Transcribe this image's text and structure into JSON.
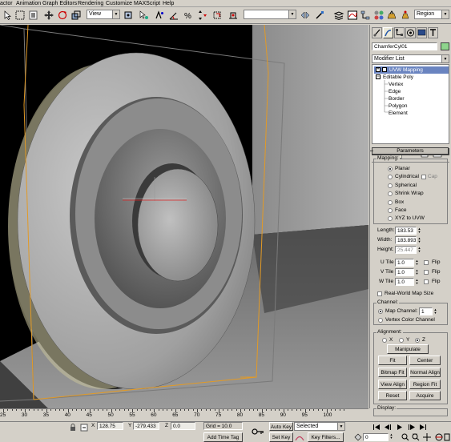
{
  "menubar": {
    "items": [
      "actor",
      "Animation",
      "Graph Editors",
      "Rendering",
      "Customize",
      "MAXScript",
      "Help"
    ]
  },
  "toolbar": {
    "view_dropdown": "View",
    "named_selection_dropdown": "",
    "region_dropdown": "Region"
  },
  "command_panel": {
    "object_name": "ChamferCyl01",
    "object_color": "#8ed48c",
    "modifier_list": "Modifier List",
    "stack": [
      {
        "label": "UVW Mapping",
        "level": 0,
        "selected": true
      },
      {
        "label": "Editable Poly",
        "level": 0,
        "selected": false
      },
      {
        "label": "Vertex",
        "level": 1,
        "selected": false
      },
      {
        "label": "Edge",
        "level": 1,
        "selected": false
      },
      {
        "label": "Border",
        "level": 1,
        "selected": false
      },
      {
        "label": "Polygon",
        "level": 1,
        "selected": false
      },
      {
        "label": "Element",
        "level": 1,
        "selected": false
      }
    ],
    "parameters": {
      "title": "Parameters",
      "mapping_label": "Mapping:",
      "mapping_options": [
        {
          "label": "Planar",
          "selected": true
        },
        {
          "label": "Cylindrical",
          "selected": false
        },
        {
          "label": "Spherical",
          "selected": false
        },
        {
          "label": "Shrink Wrap",
          "selected": false
        },
        {
          "label": "Box",
          "selected": false
        },
        {
          "label": "Face",
          "selected": false
        },
        {
          "label": "XYZ to UVW",
          "selected": false
        }
      ],
      "cap_label": "Cap",
      "length_label": "Length:",
      "length_value": "183.53",
      "width_label": "Width:",
      "width_value": "183.893",
      "height_label": "Height:",
      "height_value": "25.447",
      "utile_label": "U Tile",
      "utile_value": "1.0",
      "vtile_label": "V Tile",
      "vtile_value": "1.0",
      "wtile_label": "W Tile",
      "wtile_value": "1.0",
      "flip_label": "Flip",
      "real_world_label": "Real-World Map Size",
      "channel_label": "Channel:",
      "map_channel_label": "Map Channel:",
      "map_channel_value": "1",
      "vertex_color_label": "Vertex Color Channel",
      "alignment_label": "Alignment:",
      "align_x": "X",
      "align_y": "Y",
      "align_z": "Z",
      "manipulate": "Manipulate",
      "fit": "Fit",
      "center": "Center",
      "bitmap_fit": "Bitmap Fit",
      "normal_align": "Normal Align",
      "view_align": "View Align",
      "region_fit": "Region Fit",
      "reset": "Reset",
      "acquire": "Acquire",
      "display_label": "Display:"
    }
  },
  "timeline": {
    "ticks": [
      "25",
      "30",
      "35",
      "40",
      "45",
      "50",
      "55",
      "60",
      "65",
      "70",
      "75",
      "80",
      "85",
      "90",
      "95",
      "100"
    ]
  },
  "status": {
    "x_label": "X",
    "x_value": "128.75",
    "y_label": "Y",
    "y_value": "-279.433",
    "z_label": "Z",
    "z_value": "0.0",
    "grid": "Grid = 10.0",
    "add_time_tag": "Add Time Tag",
    "auto_key": "Auto Key",
    "selected": "Selected",
    "set_key": "Set Key",
    "key_filters": "Key Filters...",
    "frame": "0"
  }
}
